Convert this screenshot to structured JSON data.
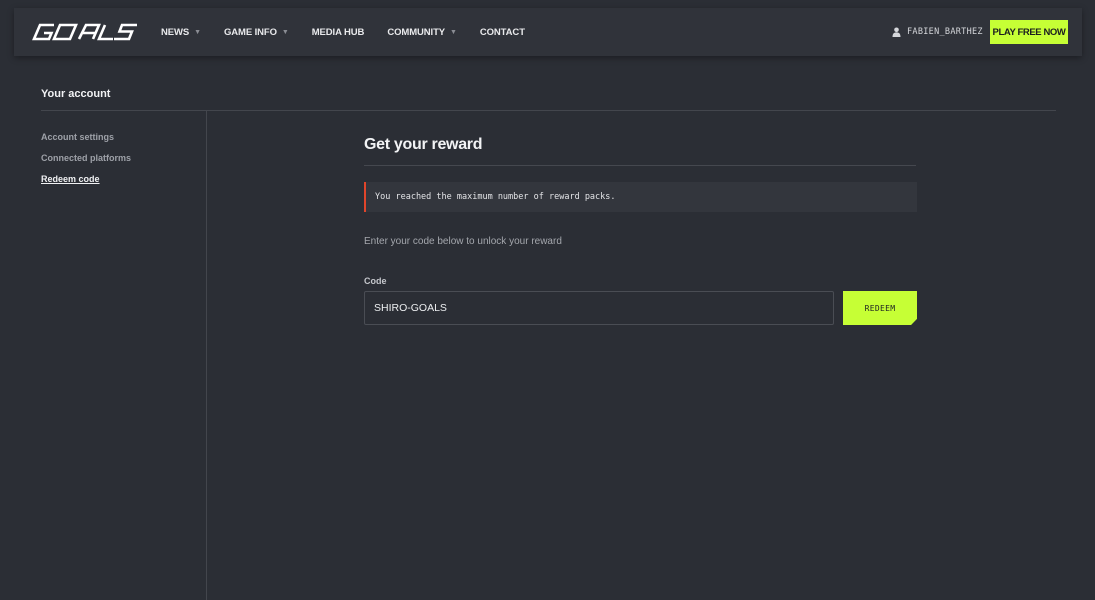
{
  "header": {
    "logo_text": "GOALS",
    "nav": [
      {
        "label": "NEWS",
        "has_dropdown": true
      },
      {
        "label": "GAME INFO",
        "has_dropdown": true
      },
      {
        "label": "MEDIA HUB",
        "has_dropdown": false
      },
      {
        "label": "COMMUNITY",
        "has_dropdown": true
      },
      {
        "label": "CONTACT",
        "has_dropdown": false
      }
    ],
    "dropdown_icon": "chevron-down-icon",
    "user_icon": "user-icon",
    "username": "FABIEN_BARTHEZ",
    "cta_label": "PLAY FREE NOW",
    "accent_color": "#c6ff35"
  },
  "account": {
    "title": "Your account",
    "sidebar": [
      {
        "label": "Account settings",
        "active": false
      },
      {
        "label": "Connected platforms",
        "active": false
      },
      {
        "label": "Redeem code",
        "active": true
      }
    ]
  },
  "reward": {
    "title": "Get your reward",
    "alert_message": "You reached the maximum number of reward packs.",
    "alert_color": "#e0452b",
    "instruction": "Enter your code below to unlock your reward",
    "code_label": "Code",
    "code_value": "SHIRO-GOALS",
    "redeem_label": "REDEEM"
  }
}
